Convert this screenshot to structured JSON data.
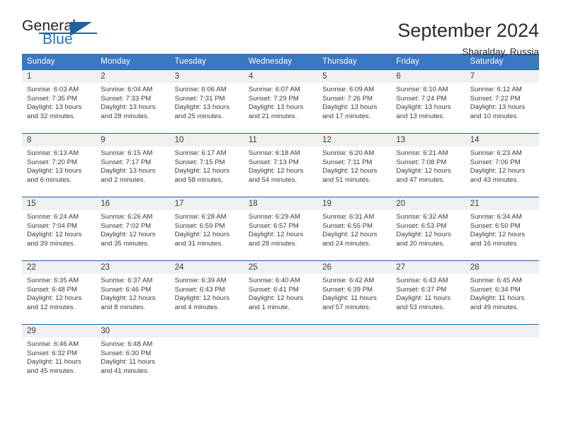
{
  "brand": {
    "name_part1": "General",
    "name_part2": "Blue",
    "triangle_color": "#1b62a8",
    "blue_text_color": "#1b75bc"
  },
  "header": {
    "title": "September 2024",
    "location": "Sharalday, Russia",
    "header_bg_color": "#3a78bf",
    "header_text_color": "#ffffff",
    "cell_band_color": "#f0f0f0",
    "row_rule_color": "#1b62a8"
  },
  "weekday_headers": [
    "Sunday",
    "Monday",
    "Tuesday",
    "Wednesday",
    "Thursday",
    "Friday",
    "Saturday"
  ],
  "labels": {
    "sunrise": "Sunrise:",
    "sunset": "Sunset:",
    "daylight": "Daylight:"
  },
  "weeks": [
    [
      {
        "day": "1",
        "sunrise": "Sunrise: 6:03 AM",
        "sunset": "Sunset: 7:35 PM",
        "daylight": "Daylight: 13 hours and 32 minutes."
      },
      {
        "day": "2",
        "sunrise": "Sunrise: 6:04 AM",
        "sunset": "Sunset: 7:33 PM",
        "daylight": "Daylight: 13 hours and 28 minutes."
      },
      {
        "day": "3",
        "sunrise": "Sunrise: 6:06 AM",
        "sunset": "Sunset: 7:31 PM",
        "daylight": "Daylight: 13 hours and 25 minutes."
      },
      {
        "day": "4",
        "sunrise": "Sunrise: 6:07 AM",
        "sunset": "Sunset: 7:29 PM",
        "daylight": "Daylight: 13 hours and 21 minutes."
      },
      {
        "day": "5",
        "sunrise": "Sunrise: 6:09 AM",
        "sunset": "Sunset: 7:26 PM",
        "daylight": "Daylight: 13 hours and 17 minutes."
      },
      {
        "day": "6",
        "sunrise": "Sunrise: 6:10 AM",
        "sunset": "Sunset: 7:24 PM",
        "daylight": "Daylight: 13 hours and 13 minutes."
      },
      {
        "day": "7",
        "sunrise": "Sunrise: 6:12 AM",
        "sunset": "Sunset: 7:22 PM",
        "daylight": "Daylight: 13 hours and 10 minutes."
      }
    ],
    [
      {
        "day": "8",
        "sunrise": "Sunrise: 6:13 AM",
        "sunset": "Sunset: 7:20 PM",
        "daylight": "Daylight: 13 hours and 6 minutes."
      },
      {
        "day": "9",
        "sunrise": "Sunrise: 6:15 AM",
        "sunset": "Sunset: 7:17 PM",
        "daylight": "Daylight: 13 hours and 2 minutes."
      },
      {
        "day": "10",
        "sunrise": "Sunrise: 6:17 AM",
        "sunset": "Sunset: 7:15 PM",
        "daylight": "Daylight: 12 hours and 58 minutes."
      },
      {
        "day": "11",
        "sunrise": "Sunrise: 6:18 AM",
        "sunset": "Sunset: 7:13 PM",
        "daylight": "Daylight: 12 hours and 54 minutes."
      },
      {
        "day": "12",
        "sunrise": "Sunrise: 6:20 AM",
        "sunset": "Sunset: 7:11 PM",
        "daylight": "Daylight: 12 hours and 51 minutes."
      },
      {
        "day": "13",
        "sunrise": "Sunrise: 6:21 AM",
        "sunset": "Sunset: 7:08 PM",
        "daylight": "Daylight: 12 hours and 47 minutes."
      },
      {
        "day": "14",
        "sunrise": "Sunrise: 6:23 AM",
        "sunset": "Sunset: 7:06 PM",
        "daylight": "Daylight: 12 hours and 43 minutes."
      }
    ],
    [
      {
        "day": "15",
        "sunrise": "Sunrise: 6:24 AM",
        "sunset": "Sunset: 7:04 PM",
        "daylight": "Daylight: 12 hours and 39 minutes."
      },
      {
        "day": "16",
        "sunrise": "Sunrise: 6:26 AM",
        "sunset": "Sunset: 7:02 PM",
        "daylight": "Daylight: 12 hours and 35 minutes."
      },
      {
        "day": "17",
        "sunrise": "Sunrise: 6:28 AM",
        "sunset": "Sunset: 6:59 PM",
        "daylight": "Daylight: 12 hours and 31 minutes."
      },
      {
        "day": "18",
        "sunrise": "Sunrise: 6:29 AM",
        "sunset": "Sunset: 6:57 PM",
        "daylight": "Daylight: 12 hours and 28 minutes."
      },
      {
        "day": "19",
        "sunrise": "Sunrise: 6:31 AM",
        "sunset": "Sunset: 6:55 PM",
        "daylight": "Daylight: 12 hours and 24 minutes."
      },
      {
        "day": "20",
        "sunrise": "Sunrise: 6:32 AM",
        "sunset": "Sunset: 6:53 PM",
        "daylight": "Daylight: 12 hours and 20 minutes."
      },
      {
        "day": "21",
        "sunrise": "Sunrise: 6:34 AM",
        "sunset": "Sunset: 6:50 PM",
        "daylight": "Daylight: 12 hours and 16 minutes."
      }
    ],
    [
      {
        "day": "22",
        "sunrise": "Sunrise: 6:35 AM",
        "sunset": "Sunset: 6:48 PM",
        "daylight": "Daylight: 12 hours and 12 minutes."
      },
      {
        "day": "23",
        "sunrise": "Sunrise: 6:37 AM",
        "sunset": "Sunset: 6:46 PM",
        "daylight": "Daylight: 12 hours and 8 minutes."
      },
      {
        "day": "24",
        "sunrise": "Sunrise: 6:39 AM",
        "sunset": "Sunset: 6:43 PM",
        "daylight": "Daylight: 12 hours and 4 minutes."
      },
      {
        "day": "25",
        "sunrise": "Sunrise: 6:40 AM",
        "sunset": "Sunset: 6:41 PM",
        "daylight": "Daylight: 12 hours and 1 minute."
      },
      {
        "day": "26",
        "sunrise": "Sunrise: 6:42 AM",
        "sunset": "Sunset: 6:39 PM",
        "daylight": "Daylight: 11 hours and 57 minutes."
      },
      {
        "day": "27",
        "sunrise": "Sunrise: 6:43 AM",
        "sunset": "Sunset: 6:37 PM",
        "daylight": "Daylight: 11 hours and 53 minutes."
      },
      {
        "day": "28",
        "sunrise": "Sunrise: 6:45 AM",
        "sunset": "Sunset: 6:34 PM",
        "daylight": "Daylight: 11 hours and 49 minutes."
      }
    ],
    [
      {
        "day": "29",
        "sunrise": "Sunrise: 6:46 AM",
        "sunset": "Sunset: 6:32 PM",
        "daylight": "Daylight: 11 hours and 45 minutes."
      },
      {
        "day": "30",
        "sunrise": "Sunrise: 6:48 AM",
        "sunset": "Sunset: 6:30 PM",
        "daylight": "Daylight: 11 hours and 41 minutes."
      },
      {
        "day": "",
        "sunrise": "",
        "sunset": "",
        "daylight": ""
      },
      {
        "day": "",
        "sunrise": "",
        "sunset": "",
        "daylight": ""
      },
      {
        "day": "",
        "sunrise": "",
        "sunset": "",
        "daylight": ""
      },
      {
        "day": "",
        "sunrise": "",
        "sunset": "",
        "daylight": ""
      },
      {
        "day": "",
        "sunrise": "",
        "sunset": "",
        "daylight": ""
      }
    ]
  ]
}
